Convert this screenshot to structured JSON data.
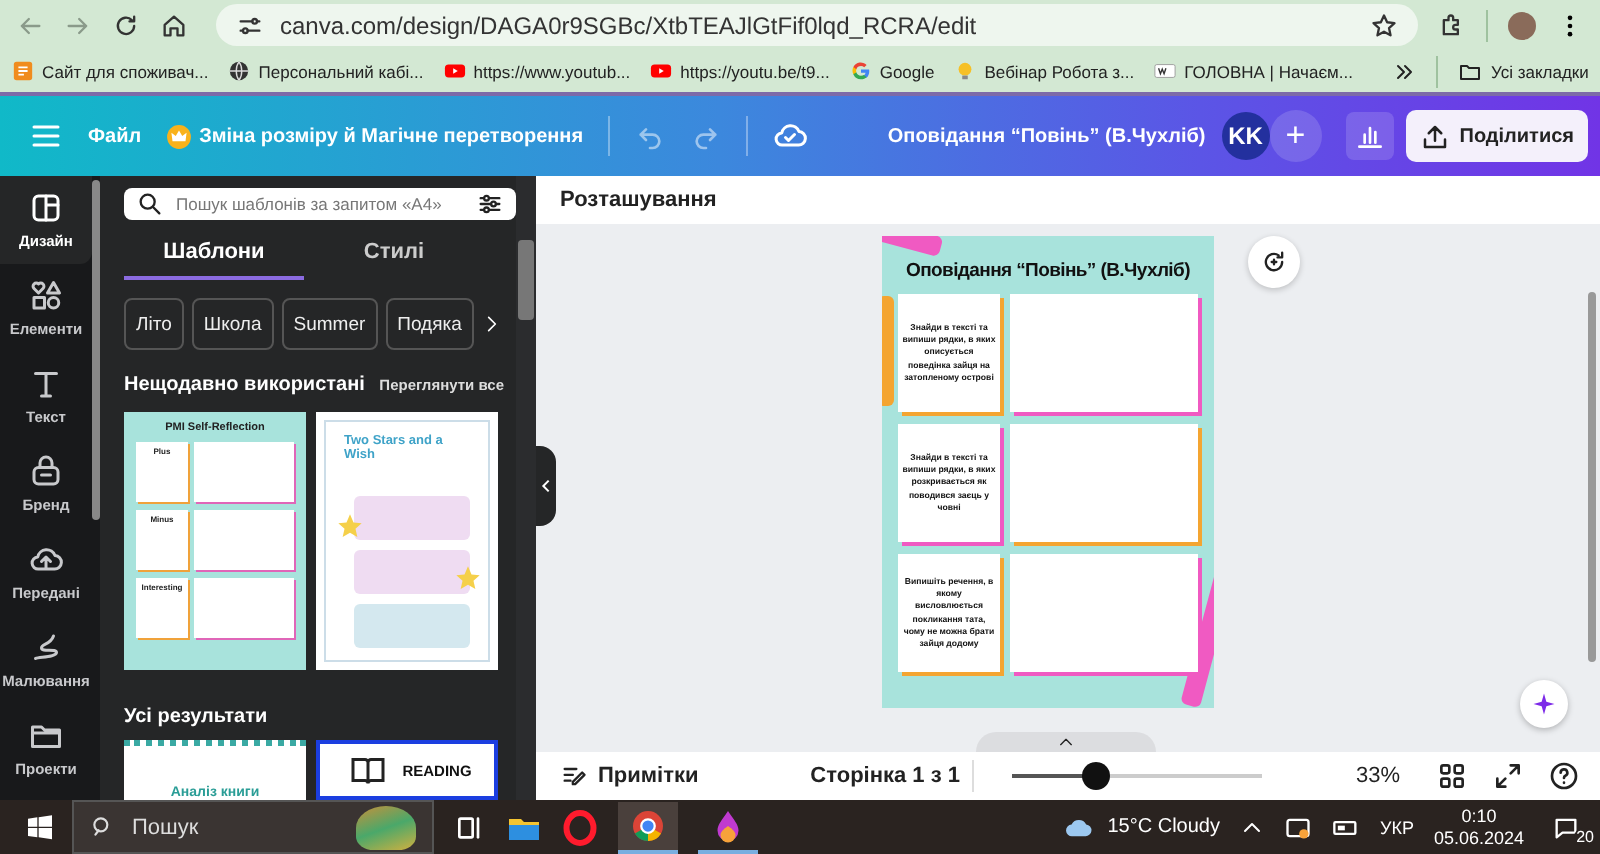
{
  "browser": {
    "url": "canva.com/design/DAGA0r9SGBc/XtbTEAJlGtFif0lqd_RCRA/edit",
    "bookmarks": [
      {
        "label": "Сайт для споживач...",
        "kind": "orange"
      },
      {
        "label": "Персональний кабі...",
        "kind": "globe"
      },
      {
        "label": "https://www.youtub...",
        "kind": "youtube"
      },
      {
        "label": "https://youtu.be/t9...",
        "kind": "youtube"
      },
      {
        "label": "Google",
        "kind": "google"
      },
      {
        "label": "Вебінар Робота з...",
        "kind": "bulb"
      },
      {
        "label": "ГОЛОВНА | Начаєм...",
        "kind": "wix"
      }
    ],
    "all_bookmarks": "Усі закладки"
  },
  "topbar": {
    "file": "Файл",
    "resize": "Зміна розміру й Магічне перетворення",
    "doc_title": "Оповідання “Повінь” (В.Чухліб)",
    "avatar": "KK",
    "add": "+",
    "share": "Поділитися"
  },
  "rail": [
    {
      "label": "Дизайн",
      "kind": "design",
      "selected": true
    },
    {
      "label": "Елементи",
      "kind": "elements",
      "selected": false
    },
    {
      "label": "Текст",
      "kind": "text",
      "selected": false
    },
    {
      "label": "Бренд",
      "kind": "brand",
      "selected": false
    },
    {
      "label": "Передані",
      "kind": "upload",
      "selected": false
    },
    {
      "label": "Малювання",
      "kind": "draw",
      "selected": false
    },
    {
      "label": "Проекти",
      "kind": "folder",
      "selected": false
    }
  ],
  "panel": {
    "search": {
      "placeholder": "Пошук шаблонів за запитом «A4»"
    },
    "tabs": [
      {
        "label": "Шаблони",
        "selected": true
      },
      {
        "label": "Стилі",
        "selected": false
      }
    ],
    "chips": [
      "Літо",
      "Школа",
      "Summer",
      "Подяка"
    ],
    "recent_heading": "Нещодавно використані",
    "see_all": "Переглянути все",
    "templates": [
      {
        "kind": "pmi",
        "title": "PMI Self-Reflection",
        "sections": [
          "Plus",
          "Minus",
          "Interesting"
        ]
      },
      {
        "kind": "stars",
        "title": "Two Stars and a Wish"
      }
    ],
    "results_heading": "Усі результати",
    "results": [
      {
        "kind": "banner",
        "title": "Аналіз книги"
      },
      {
        "kind": "book",
        "title": "READING"
      }
    ]
  },
  "editor": {
    "header": "Розташування",
    "page": {
      "title": "Оповідання “Повінь” (В.Чухліб)",
      "tasks": [
        "Знайди в тексті та випиши рядки, в яких описується поведінка зайця на затопленому острові",
        "Знайди в тексті та випиши рядки, в яких розкривається як поводився заєць у човні",
        "Випишіть речення, в якому висловлюється покликання тата, чому не можна брати зайця додому"
      ]
    }
  },
  "footer": {
    "notes": "Примітки",
    "page_counter": "Сторінка 1 з 1",
    "zoom": {
      "level": 0.3
    },
    "zoom_reading": "33%"
  },
  "taskbar": {
    "search_placeholder": "Пошук",
    "weather": "15°C Cloudy",
    "language": "УКР",
    "time": "0:10",
    "date": "05.06.2024",
    "notifications": "20"
  }
}
